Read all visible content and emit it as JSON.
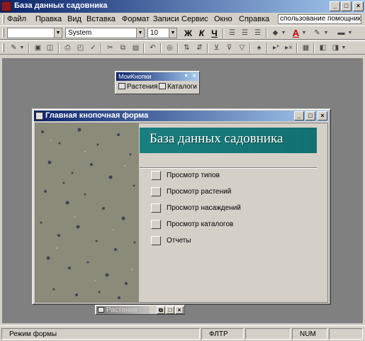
{
  "app": {
    "title": "База данных садовника",
    "controls": [
      "_",
      "□",
      "×"
    ]
  },
  "menubar": {
    "items": [
      "Файл",
      "Правка",
      "Вид",
      "Вставка",
      "Формат",
      "Записи",
      "Сервис",
      "Окно",
      "Справка"
    ],
    "help_text": "спользование помощника"
  },
  "toolbar1": {
    "style_value": "",
    "font_value": "System",
    "size_value": "10",
    "bold": "Ж",
    "italic": "К",
    "underline": "Ч",
    "font_color_glyph": "A"
  },
  "toolbar2": {
    "icon_names": [
      "view-icon",
      "save-icon",
      "print-icon",
      "cut-icon",
      "copy-icon",
      "paste-icon",
      "undo-icon",
      "sort-icon",
      "filter-icon",
      "find-icon",
      "new-record-icon",
      "delete-icon",
      "properties-icon",
      "database-icon",
      "new-object-icon"
    ]
  },
  "float_toolbar": {
    "title": "МоиКнопки",
    "buttons": [
      "Растения",
      "Каталоги"
    ]
  },
  "form_window": {
    "title": "Главная кнопочная форма",
    "header": "База данных садовника",
    "options": [
      "Просмотр типов",
      "Просмотр растений",
      "Просмотр насаждений",
      "Просмотр каталогов",
      "Отчеты"
    ]
  },
  "minimized": {
    "title": "Растения"
  },
  "status": {
    "mode": "Режим формы",
    "filter": "ФЛТР",
    "num": "NUM"
  },
  "colors": {
    "title_gradient_start": "#0a246a",
    "header_band": "#1a7f7f",
    "workspace": "#808080"
  }
}
